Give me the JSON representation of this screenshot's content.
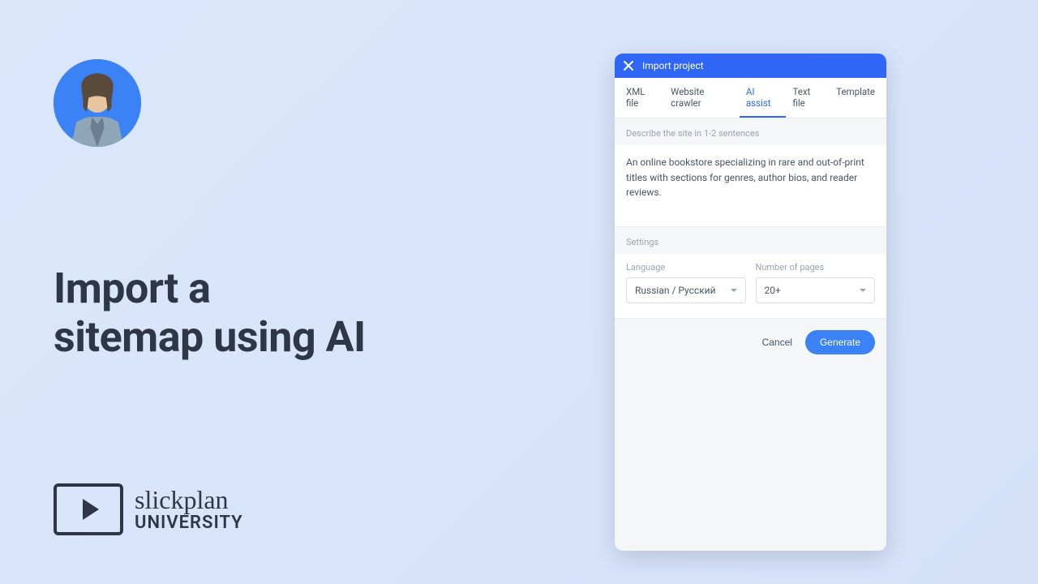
{
  "headline": "Import a\nsitemap using AI",
  "brand": {
    "script": "slickplan",
    "caps": "UNIVERSITY"
  },
  "modal": {
    "title": "Import project",
    "tabs": [
      "XML file",
      "Website crawler",
      "AI assist",
      "Text file",
      "Template"
    ],
    "active_tab_index": 2,
    "describe_label": "Describe the site in 1-2 sentences",
    "description": "An online bookstore specializing in rare and out-of-print titles with sections for genres, author bios, and reader reviews.",
    "settings_label": "Settings",
    "language_label": "Language",
    "language_value": "Russian / Русский",
    "pages_label": "Number of pages",
    "pages_value": "20+",
    "cancel": "Cancel",
    "generate": "Generate"
  }
}
